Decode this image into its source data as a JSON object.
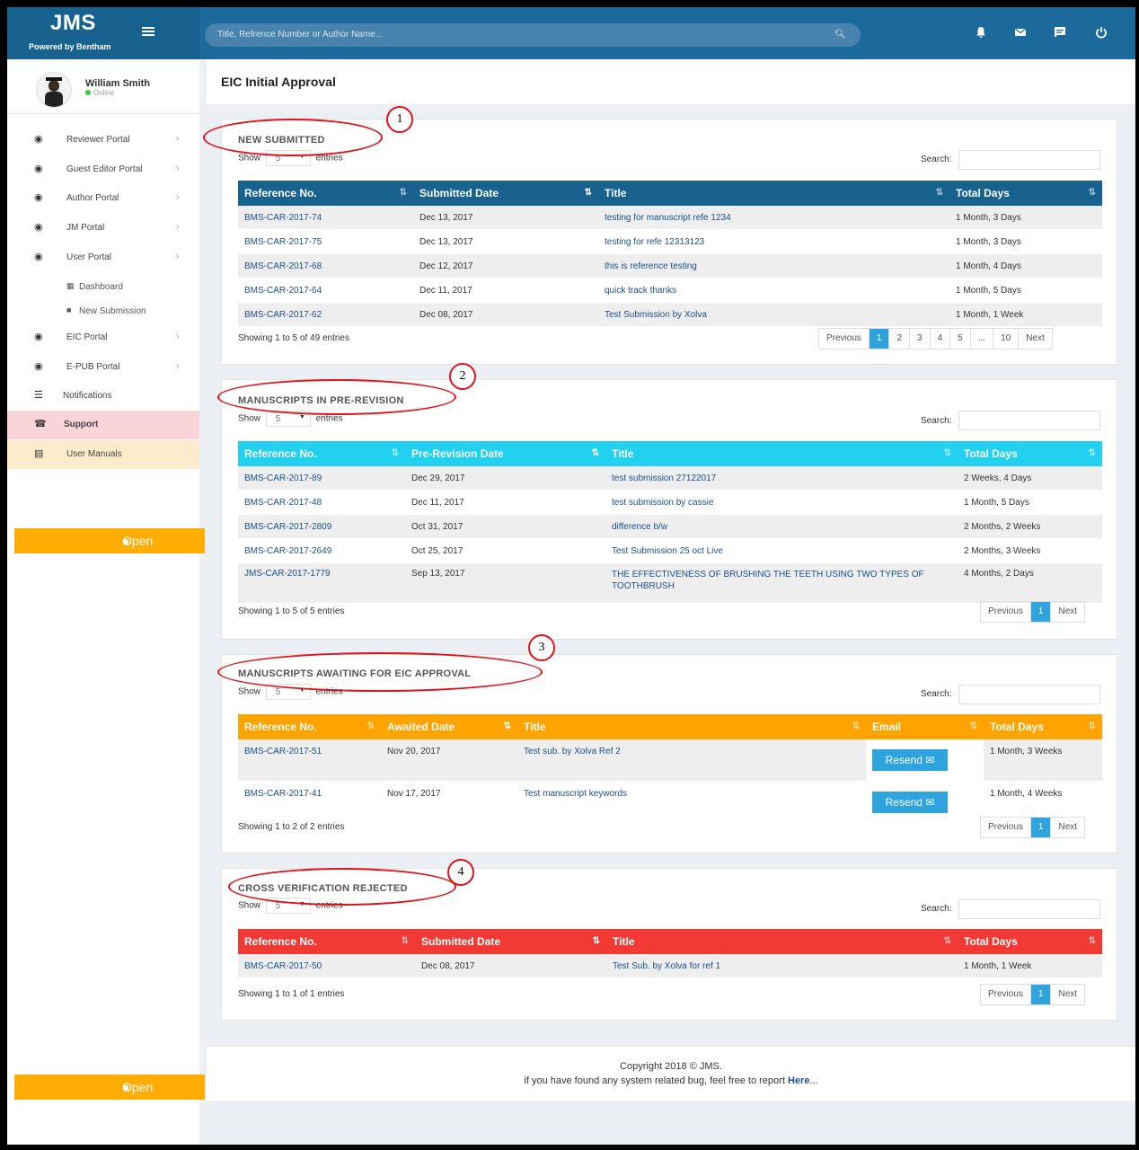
{
  "header": {
    "logo": "JMS",
    "logo_sub": "Powered by Bentham",
    "search_placeholder": "Title, Refrence Number or Author Name..."
  },
  "user": {
    "name": "William  Smith",
    "status": "Online"
  },
  "sidebar": {
    "items": [
      {
        "label": "Reviewer Portal"
      },
      {
        "label": "Guest Editor Portal"
      },
      {
        "label": "Author Portal"
      },
      {
        "label": "JM Portal"
      },
      {
        "label": "User Portal"
      },
      {
        "label": "Dashboard"
      },
      {
        "label": "New Submission"
      },
      {
        "label": "EIC Portal"
      },
      {
        "label": "E-PUB Portal"
      },
      {
        "label": "Notifications"
      },
      {
        "label": "Support"
      },
      {
        "label": "User Manuals"
      }
    ],
    "open_chat": "Open Chat"
  },
  "page_title": "EIC Initial Approval",
  "common": {
    "show": "Show",
    "entries": "entries",
    "search": "Search:",
    "page_size": "5",
    "previous": "Previous",
    "next": "Next"
  },
  "new_submitted": {
    "title": "NEW SUBMITTED",
    "headers": [
      "Reference No.",
      "Submitted Date",
      "Title",
      "Total Days"
    ],
    "rows": [
      [
        "BMS-CAR-2017-74",
        "Dec 13, 2017",
        "testing for manuscript refe 1234",
        "1 Month, 3 Days"
      ],
      [
        "BMS-CAR-2017-75",
        "Dec 13, 2017",
        "testing for refe 12313123",
        "1 Month, 3 Days"
      ],
      [
        "BMS-CAR-2017-68",
        "Dec 12, 2017",
        "this is reference testing",
        "1 Month, 4 Days"
      ],
      [
        "BMS-CAR-2017-64",
        "Dec 11, 2017",
        "quick track thanks",
        "1 Month, 5 Days"
      ],
      [
        "BMS-CAR-2017-62",
        "Dec 08, 2017",
        "Test Submission by Xolva",
        "1 Month, 1 Week"
      ]
    ],
    "showing": "Showing 1 to 5 of 49 entries",
    "pages": [
      "1",
      "2",
      "3",
      "4",
      "5",
      "...",
      "10"
    ]
  },
  "pre_revision": {
    "title": "MANUSCRIPTS IN PRE-REVISION",
    "headers": [
      "Reference No.",
      "Pre-Revision Date",
      "Title",
      "Total Days"
    ],
    "rows": [
      [
        "BMS-CAR-2017-89",
        "Dec 29, 2017",
        "test submission 27122017",
        "2 Weeks, 4 Days"
      ],
      [
        "BMS-CAR-2017-48",
        "Dec 11, 2017",
        "test submission by cassie",
        "1 Month, 5 Days"
      ],
      [
        "BMS-CAR-2017-2809",
        "Oct 31, 2017",
        "difference b/w",
        "2 Months, 2 Weeks"
      ],
      [
        "BMS-CAR-2017-2649",
        "Oct 25, 2017",
        "Test Submission 25 oct Live",
        "2 Months, 3 Weeks"
      ],
      [
        "JMS-CAR-2017-1779",
        "Sep 13, 2017",
        "THE EFFECTIVENESS OF BRUSHING THE TEETH USING TWO TYPES OF TOOTHBRUSH",
        "4 Months, 2 Days"
      ]
    ],
    "showing": "Showing 1 to 5 of 5 entries",
    "pages": [
      "1"
    ]
  },
  "awaiting": {
    "title": "MANUSCRIPTS AWAITING FOR EIC APPROVAL",
    "headers": [
      "Reference No.",
      "Awaited Date",
      "Title",
      "Email",
      "Total Days"
    ],
    "rows": [
      [
        "BMS-CAR-2017-51",
        "Nov 20, 2017",
        "Test sub. by Xolva Ref 2",
        "Resend",
        "1 Month, 3 Weeks"
      ],
      [
        "BMS-CAR-2017-41",
        "Nov 17, 2017",
        "Test manuscript keywords",
        "Resend",
        "1 Month, 4 Weeks"
      ]
    ],
    "showing": "Showing 1 to 2 of 2 entries",
    "pages": [
      "1"
    ]
  },
  "rejected": {
    "title": "CROSS VERIFICATION REJECTED",
    "headers": [
      "Reference No.",
      "Submitted Date",
      "Title",
      "Total Days"
    ],
    "rows": [
      [
        "BMS-CAR-2017-50",
        "Dec 08, 2017",
        "Test Sub. by Xolva for ref 1",
        "1 Month, 1 Week"
      ]
    ],
    "showing": "Showing 1 to 1 of 1 entries",
    "pages": [
      "1"
    ]
  },
  "annotations": [
    "1",
    "2",
    "3",
    "4"
  ],
  "footer": {
    "copyright": "Copyright 2018 © JMS.",
    "bug_text": "if you have found any system related bug, feel free to report ",
    "here": "Here",
    "dots": "..."
  },
  "colors": {
    "header": "#1b6a9b",
    "blue_table": "#17628f",
    "cyan_table": "#22d0f0",
    "orange_table": "#ffa301",
    "red_table": "#f03a33",
    "annotation": "#e0131b"
  }
}
